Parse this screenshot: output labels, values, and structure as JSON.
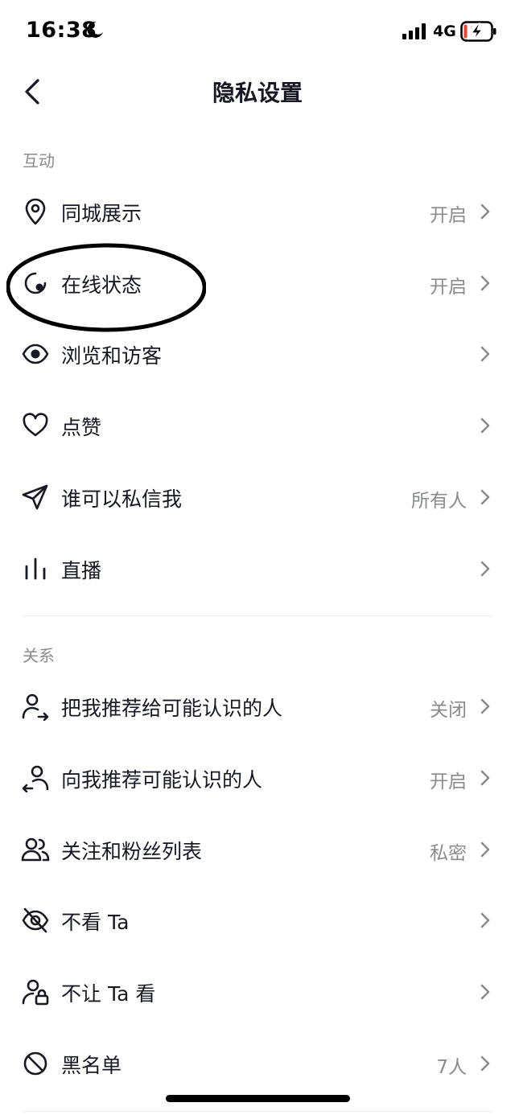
{
  "status_bar": {
    "time": "16:38",
    "network": "4G",
    "icons": [
      "moon-icon",
      "signal-icon",
      "battery-charging-icon"
    ]
  },
  "nav": {
    "title": "隐私设置",
    "back_icon": "chevron-left-icon"
  },
  "sections": [
    {
      "header": "互动",
      "items": [
        {
          "label": "同城展示",
          "value": "开启",
          "icon": "location-pin-icon"
        },
        {
          "label": "在线状态",
          "value": "开启",
          "icon": "online-status-icon"
        },
        {
          "label": "浏览和访客",
          "value": "",
          "icon": "eye-icon"
        },
        {
          "label": "点赞",
          "value": "",
          "icon": "heart-icon"
        },
        {
          "label": "谁可以私信我",
          "value": "所有人",
          "icon": "paper-plane-icon"
        },
        {
          "label": "直播",
          "value": "",
          "icon": "live-bars-icon"
        }
      ]
    },
    {
      "header": "关系",
      "items": [
        {
          "label": "把我推荐给可能认识的人",
          "value": "关闭",
          "icon": "user-share-icon"
        },
        {
          "label": "向我推荐可能认识的人",
          "value": "开启",
          "icon": "user-recommend-icon"
        },
        {
          "label": "关注和粉丝列表",
          "value": "私密",
          "icon": "users-icon"
        },
        {
          "label": "不看 Ta",
          "value": "",
          "icon": "eye-off-icon"
        },
        {
          "label": "不让 Ta 看",
          "value": "",
          "icon": "user-lock-icon"
        },
        {
          "label": "黑名单",
          "value": "7人",
          "icon": "block-icon"
        }
      ]
    }
  ],
  "colors": {
    "text": "#161823",
    "secondary": "#8a8b91",
    "divider": "#ececec",
    "background": "#ffffff",
    "annotation": "#000000"
  }
}
